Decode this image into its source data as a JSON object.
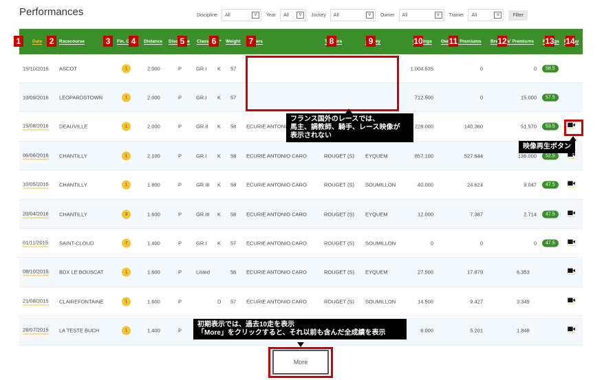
{
  "title": "Performances",
  "filters": [
    {
      "label": "Discipline",
      "value": "All"
    },
    {
      "label": "Year",
      "value": "All"
    },
    {
      "label": "Jockey",
      "value": "All"
    },
    {
      "label": "Owner",
      "value": "All"
    },
    {
      "label": "Trainer",
      "value": "All"
    }
  ],
  "filter_button": "Filter",
  "columns": [
    "Date",
    "Racecourse",
    "Fin. Order",
    "Distance",
    "Discipline",
    "Class",
    "*",
    "Weight",
    "Owners",
    "Trainers",
    "Jockey",
    "Earnings",
    "Owners' Premiums",
    "Breeders' Premiums",
    "Ratings",
    "Replay"
  ],
  "column_numbers": [
    "1",
    "2",
    "3",
    "4",
    "5",
    "6",
    "7",
    "8",
    "9",
    "10",
    "11",
    "12",
    "13",
    "14"
  ],
  "rows": [
    {
      "date": "15/10/2016",
      "course": "ASCOT",
      "place": "1",
      "distance": "2.000",
      "discipline": "P",
      "class": "GR.I",
      "star": "K",
      "weight": "57",
      "owner": "",
      "trainer": "",
      "jockey": "",
      "earnings": "1.004.535",
      "owners_prem": "0",
      "breeders_prem": "0",
      "rating": "58.5",
      "replay": false
    },
    {
      "date": "10/09/2016",
      "course": "LEOPARDSTOWN",
      "place": "1",
      "distance": "2.000",
      "discipline": "P",
      "class": "GR.I",
      "star": "K",
      "weight": "57",
      "owner": "",
      "trainer": "",
      "jockey": "",
      "earnings": "712.500",
      "owners_prem": "0",
      "breeders_prem": "15.000",
      "rating": "57.5",
      "replay": false
    },
    {
      "date": "15/08/2016",
      "course": "DEAUVILLE",
      "place": "1",
      "distance": "2.000",
      "discipline": "P",
      "class": "GR.II",
      "star": "K",
      "weight": "58",
      "owner": "ECURIE ANTONIO CARO",
      "trainer": "",
      "jockey": "",
      "earnings": "228.000",
      "owners_prem": "140.360",
      "breeders_prem": "51.570",
      "rating": "53.5",
      "replay": true
    },
    {
      "date": "06/06/2016",
      "course": "CHANTILLY",
      "place": "1",
      "distance": "2.100",
      "discipline": "P",
      "class": "GR.I",
      "star": "K",
      "weight": "58",
      "owner": "ECURIE ANTONIO CARO",
      "trainer": "ROUGET (S)",
      "jockey": "EYQUEM",
      "earnings": "857.100",
      "owners_prem": "527.644",
      "breeders_prem": "136.000",
      "rating": "52.5",
      "replay": true
    },
    {
      "date": "10/05/2016",
      "course": "CHANTILLY",
      "place": "1",
      "distance": "1.800",
      "discipline": "P",
      "class": "GR.III",
      "star": "K",
      "weight": "58",
      "owner": "ECURIE ANTONIO CARO",
      "trainer": "ROUGET (S)",
      "jockey": "SOUMILLON",
      "earnings": "40.000",
      "owners_prem": "24.624",
      "breeders_prem": "9.047",
      "rating": "47.5",
      "replay": true
    },
    {
      "date": "20/04/2016",
      "course": "CHANTILLY",
      "place": "3",
      "distance": "1.600",
      "discipline": "P",
      "class": "GR.III",
      "star": "K",
      "weight": "58",
      "owner": "ECURIE ANTONIO CARO",
      "trainer": "ROUGET (S)",
      "jockey": "EYQUEM",
      "earnings": "12.000",
      "owners_prem": "7.387",
      "breeders_prem": "2.714",
      "rating": "47.5",
      "replay": true
    },
    {
      "date": "01/11/2015",
      "course": "SAINT-CLOUD",
      "place": "7",
      "distance": "1.400",
      "discipline": "P",
      "class": "GR.I",
      "star": "K",
      "weight": "57",
      "owner": "ECURIE ANTONIO CARO",
      "trainer": "ROUGET (S)",
      "jockey": "SOUMILLON",
      "earnings": "0",
      "owners_prem": "0",
      "breeders_prem": "0",
      "rating": "47.5",
      "replay": true
    },
    {
      "date": "08/10/2015",
      "course": "BDX LE BOUSCAT",
      "place": "1",
      "distance": "1.600",
      "discipline": "P",
      "class": "Listed",
      "star": "",
      "weight": "56",
      "owner": "ECURIE ANTONIO CARO",
      "trainer": "ROUGET (S)",
      "jockey": "EYQUEM",
      "earnings": "27.500",
      "owners_prem": "17.879",
      "breeders_prem": "6.353",
      "rating": "",
      "replay": true
    },
    {
      "date": "21/08/2015",
      "course": "CLAIREFONTAINE",
      "place": "1",
      "distance": "1.600",
      "discipline": "P",
      "class": "",
      "star": "D",
      "weight": "57",
      "owner": "ECURIE ANTONIO CARO",
      "trainer": "ROUGET (S)",
      "jockey": "SOUMILLON",
      "earnings": "14.500",
      "owners_prem": "9.427",
      "breeders_prem": "3.349",
      "rating": "",
      "replay": true
    },
    {
      "date": "28/07/2015",
      "course": "LA TESTE BUCH",
      "place": "1",
      "distance": "1.400",
      "discipline": "P",
      "class": "",
      "star": "",
      "weight": "",
      "owner": "",
      "trainer": "",
      "jockey": "",
      "earnings": "8.000",
      "owners_prem": "5.201",
      "breeders_prem": "1.848",
      "rating": "",
      "replay": true
    }
  ],
  "more_button": "More",
  "annotations": {
    "overseas": [
      "フランス国外のレースでは、",
      "馬主、調教師、騎手、レース映像が",
      "表示されない"
    ],
    "replay": "映像再生ボタン",
    "more": [
      "初期表示では、過去10走を表示",
      "「More」をクリックすると、それ以前も含んだ全成績を表示"
    ]
  },
  "colors": {
    "header": "#3a8f2b",
    "accent": "#f6c331",
    "annotation": "#d40000"
  }
}
